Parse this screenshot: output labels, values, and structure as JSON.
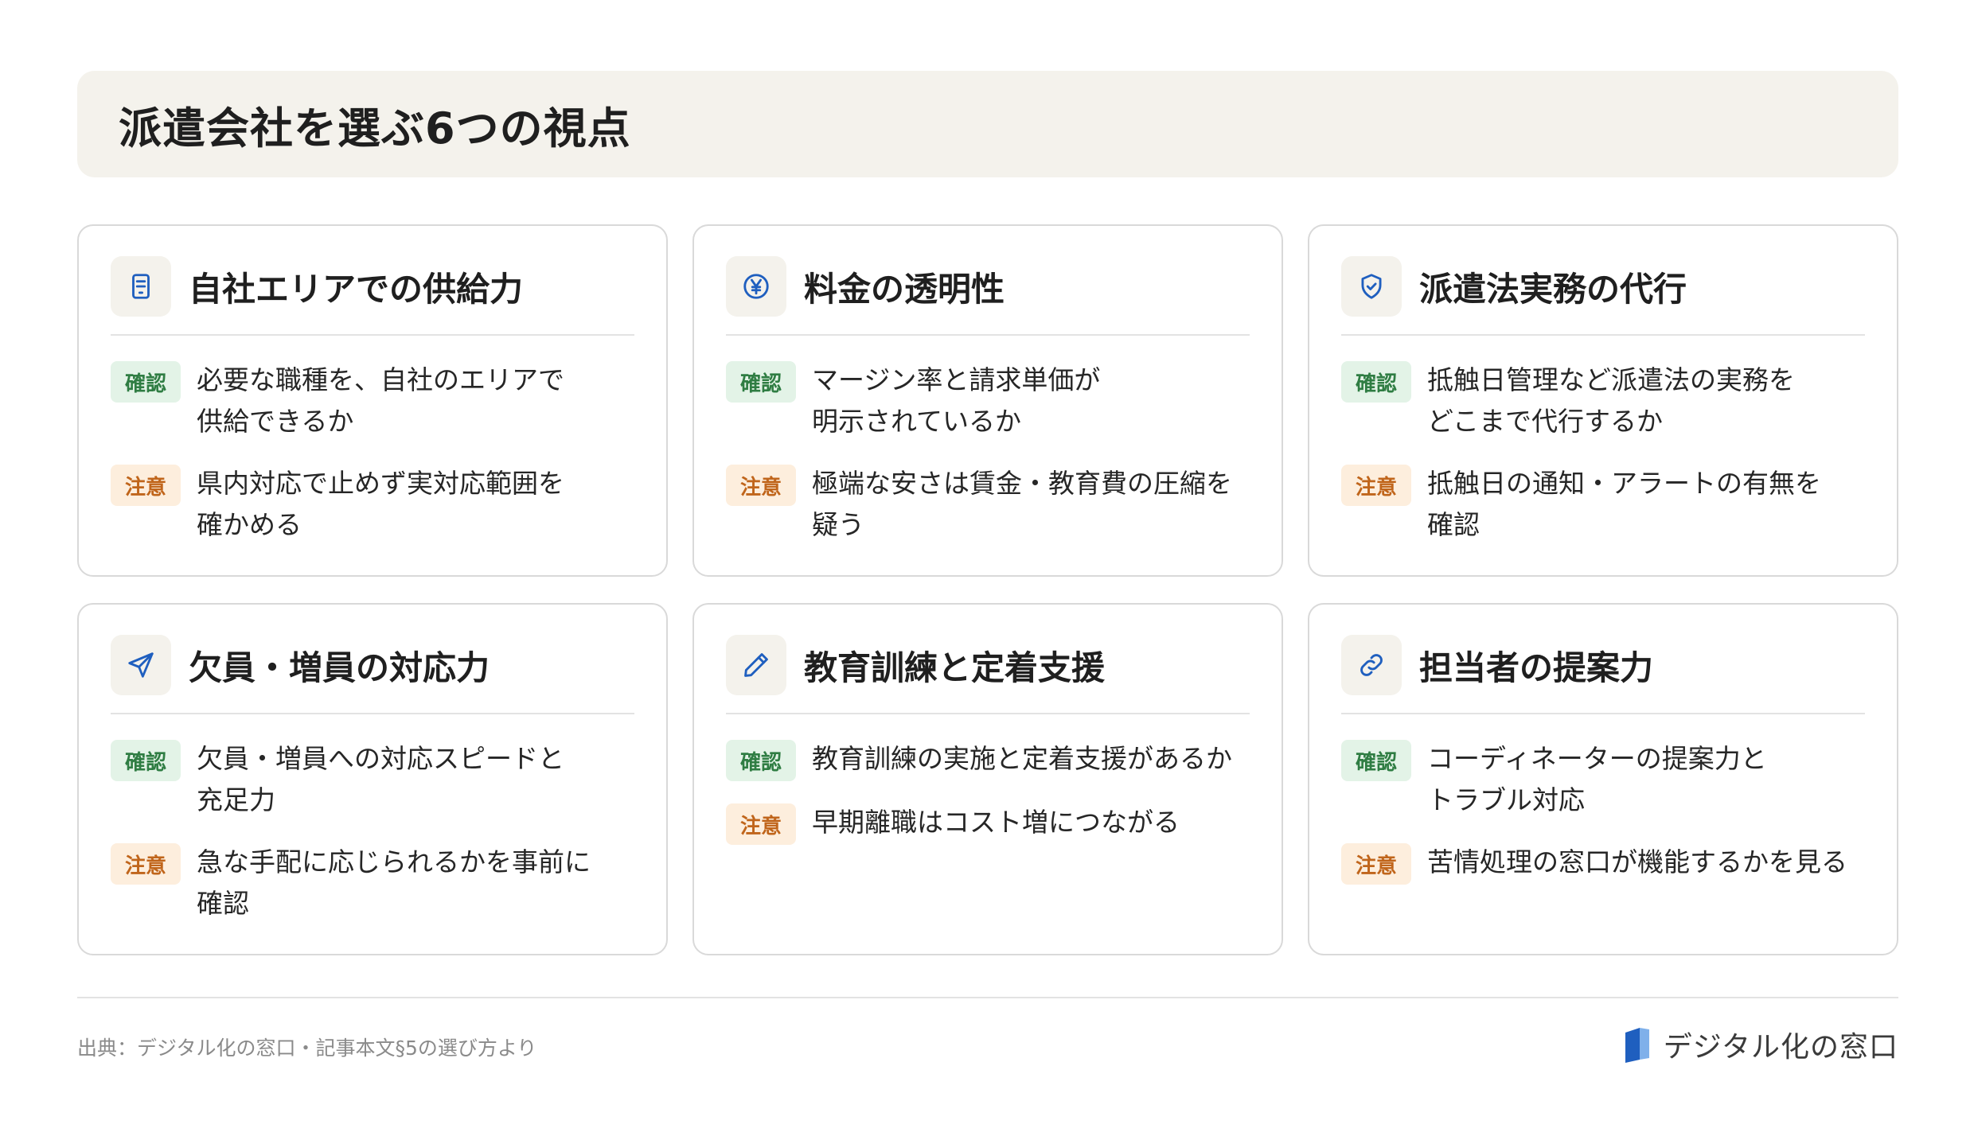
{
  "header": {
    "title": "派遣会社を選ぶ6つの視点"
  },
  "badges": {
    "check": "確認",
    "caution": "注意"
  },
  "cards": [
    {
      "title": "自社エリアでの供給力",
      "icon": "document-icon",
      "check": "必要な職種を、自社のエリアで\n供給できるか",
      "caution": "県内対応で止めず実対応範囲を\n確かめる"
    },
    {
      "title": "料金の透明性",
      "icon": "yen-icon",
      "check": "マージン率と請求単価が\n明示されているか",
      "caution": "極端な安さは賃金・教育費の圧縮を\n疑う"
    },
    {
      "title": "派遣法実務の代行",
      "icon": "shield-check-icon",
      "check": "抵触日管理など派遣法の実務を\nどこまで代行するか",
      "caution": "抵触日の通知・アラートの有無を\n確認"
    },
    {
      "title": "欠員・増員の対応力",
      "icon": "send-icon",
      "check": "欠員・増員への対応スピードと\n充足力",
      "caution": "急な手配に応じられるかを事前に\n確認"
    },
    {
      "title": "教育訓練と定着支援",
      "icon": "pencil-icon",
      "check": "教育訓練の実施と定着支援があるか",
      "caution": "早期離職はコスト増につながる"
    },
    {
      "title": "担当者の提案力",
      "icon": "link-icon",
      "check": "コーディネーターの提案力と\nトラブル対応",
      "caution": "苦情処理の窓口が機能するかを見る"
    }
  ],
  "footer": {
    "source": "出典：デジタル化の窓口・記事本文§5の選び方より",
    "logo_text": "デジタル化の窓口"
  },
  "colors": {
    "accent_blue": "#1f5fbf",
    "check_bg": "#e3f3e7",
    "check_text": "#2f7d43",
    "caution_bg": "#fdeedd",
    "caution_text": "#c0651b",
    "header_bg": "#f4f2ec"
  }
}
